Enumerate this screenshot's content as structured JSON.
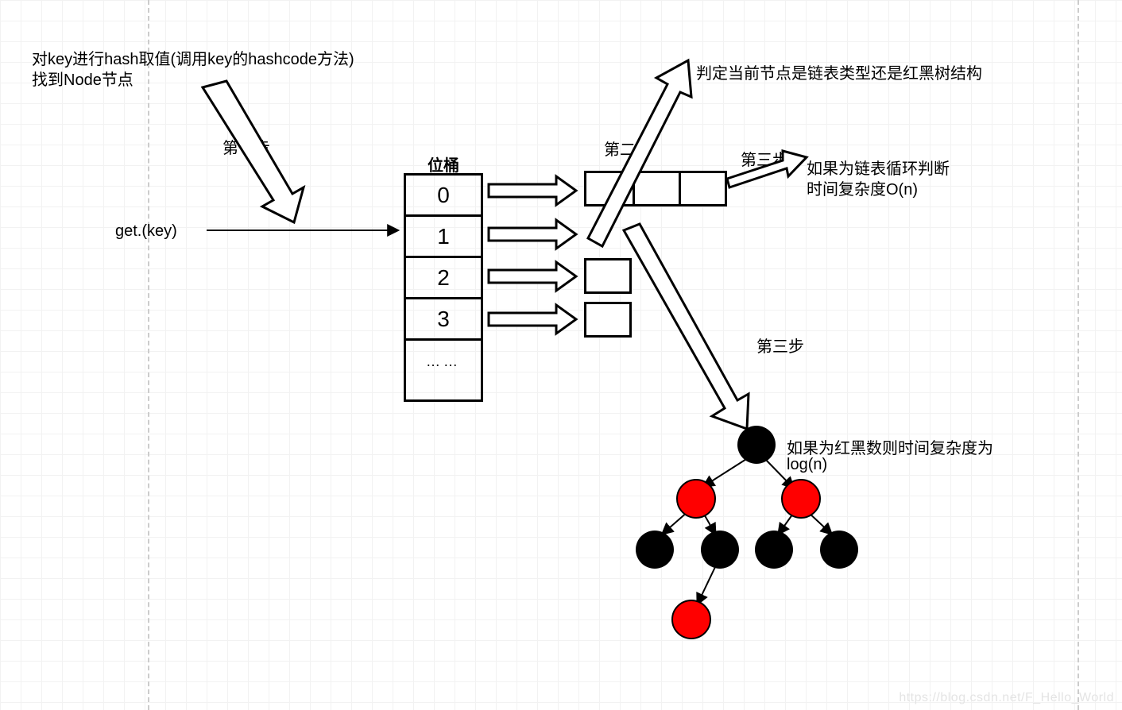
{
  "topText": {
    "line1": "对key进行hash取值(调用key的hashcode方法)",
    "line2": "找到Node节点"
  },
  "stepLabels": {
    "step1": "第一步",
    "step2": "第二步",
    "step3a": "第三步",
    "step3b": "第三步"
  },
  "notes": {
    "judge": "判定当前节点是链表类型还是红黑树结构",
    "linkedList_l1": "如果为链表循环判断",
    "linkedList_l2": "时间复杂度O(n)",
    "rbTree_l1": "如果为红黑数则时间复杂度为",
    "rbTree_l2": "log(n)"
  },
  "getCall": "get.(key)",
  "bucket": {
    "header": "位桶",
    "rows": [
      "0",
      "1",
      "2",
      "3",
      "……"
    ]
  },
  "colors": {
    "red": "#ff0000",
    "black": "#000000",
    "white": "#ffffff"
  },
  "watermark": "https://blog.csdn.net/F_Hello_World"
}
